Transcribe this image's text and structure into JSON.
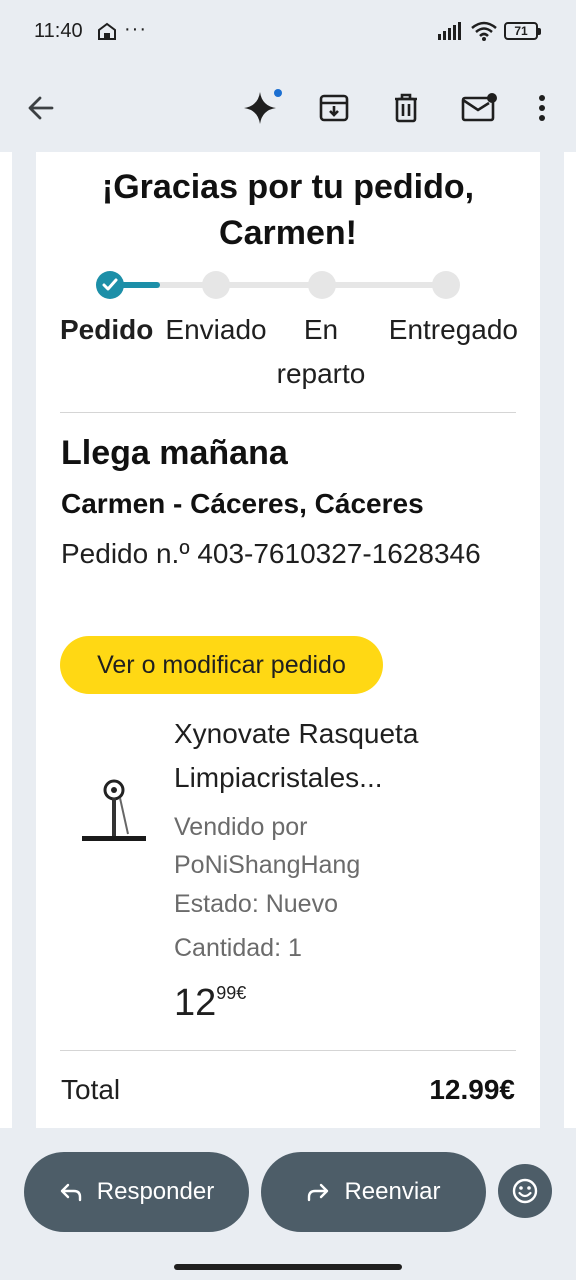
{
  "status_bar": {
    "time": "11:40",
    "dots": "···",
    "battery": "71"
  },
  "toolbar": {
    "back_icon": "arrow-left-icon",
    "gemini_icon": "sparkle-icon",
    "archive_icon": "archive-icon",
    "delete_icon": "trash-icon",
    "unread_icon": "mail-unread-icon",
    "more_icon": "more-vert-icon"
  },
  "email": {
    "title": "¡Gracias por tu pedido, Carmen!",
    "steps": [
      {
        "label": "Pedido",
        "done": true
      },
      {
        "label": "Enviado",
        "done": false
      },
      {
        "label": "En reparto",
        "done": false
      },
      {
        "label": "Entregado",
        "done": false
      }
    ],
    "arrival": "Llega mañana",
    "address": "Carmen - Cáceres, Cáceres",
    "order_number": "Pedido n.º 403-7610327-1628346",
    "cta": "Ver o modificar pedido",
    "product": {
      "name": "Xynovate Rasqueta Limpiacristales...",
      "seller": "Vendido por PoNiShangHang",
      "state": "Estado: Nuevo",
      "quantity": "Cantidad: 1",
      "price_whole": "12",
      "price_fraction": "99€"
    },
    "total_label": "Total",
    "total_value": "12.99€"
  },
  "actions": {
    "reply": "Responder",
    "forward": "Reenviar",
    "emoji_icon": "emoji-icon"
  },
  "colors": {
    "progress": "#1c8fa8",
    "cta": "#ffd814",
    "action_pill": "#4d5d68",
    "chrome": "#e9edf2"
  }
}
